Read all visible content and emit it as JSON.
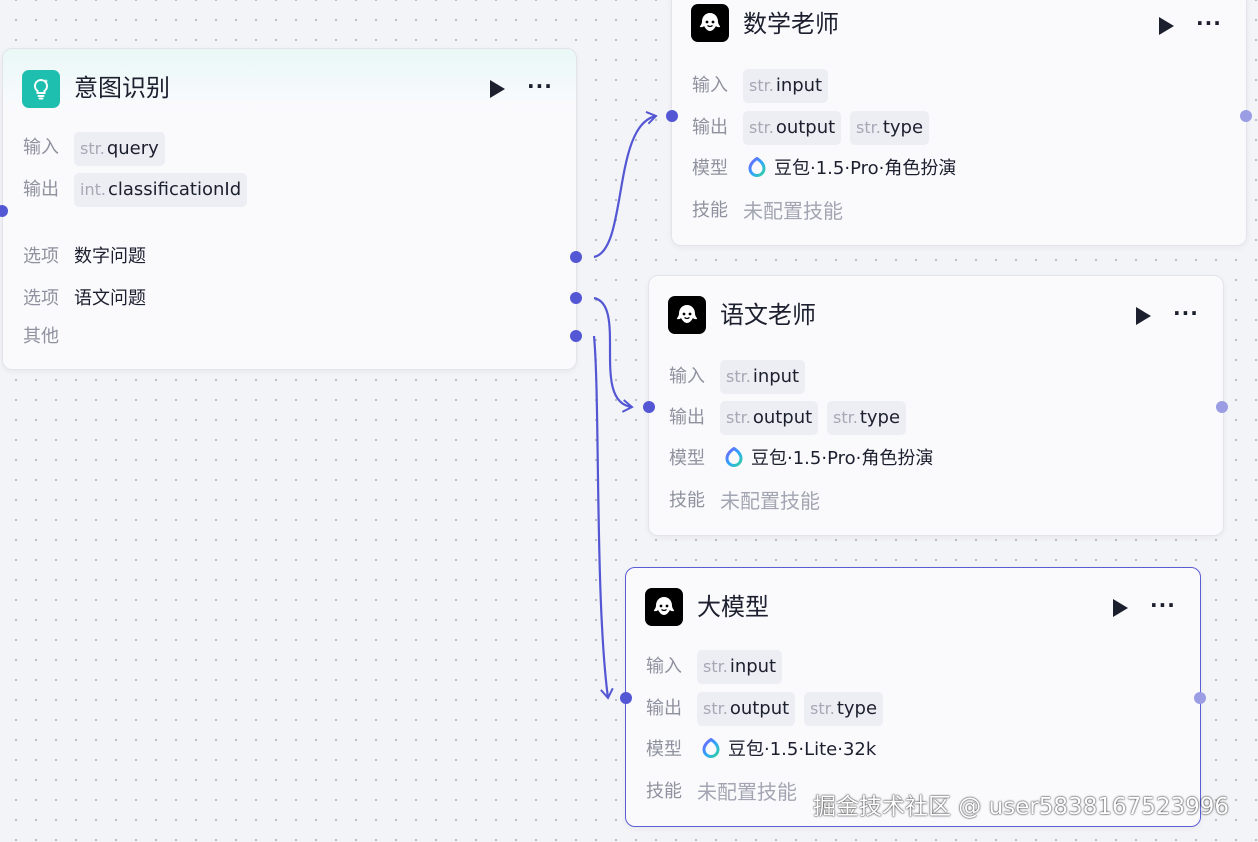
{
  "intent_node": {
    "title": "意图识别",
    "input_label": "输入",
    "input_type": "str.",
    "input_name": "query",
    "output_label": "输出",
    "output_type": "int.",
    "output_name": "classificationId",
    "options": [
      {
        "label": "选项",
        "value": "数字问题"
      },
      {
        "label": "选项",
        "value": "语文问题"
      },
      {
        "label": "其他",
        "value": ""
      }
    ]
  },
  "llm_nodes": [
    {
      "title": "数学老师",
      "input_label": "输入",
      "input_type": "str.",
      "input_name": "input",
      "output_label": "输出",
      "outputs": [
        {
          "type": "str.",
          "name": "output"
        },
        {
          "type": "str.",
          "name": "type"
        }
      ],
      "model_label": "模型",
      "model": "豆包·1.5·Pro·角色扮演",
      "skill_label": "技能",
      "skill": "未配置技能"
    },
    {
      "title": "语文老师",
      "input_label": "输入",
      "input_type": "str.",
      "input_name": "input",
      "output_label": "输出",
      "outputs": [
        {
          "type": "str.",
          "name": "output"
        },
        {
          "type": "str.",
          "name": "type"
        }
      ],
      "model_label": "模型",
      "model": "豆包·1.5·Pro·角色扮演",
      "skill_label": "技能",
      "skill": "未配置技能"
    },
    {
      "title": "大模型",
      "input_label": "输入",
      "input_type": "str.",
      "input_name": "input",
      "output_label": "输出",
      "outputs": [
        {
          "type": "str.",
          "name": "output"
        },
        {
          "type": "str.",
          "name": "type"
        }
      ],
      "model_label": "模型",
      "model": "豆包·1.5·Lite·32k",
      "skill_label": "技能",
      "skill": "未配置技能"
    }
  ],
  "colors": {
    "edge": "#5457d4",
    "selected_border": "#5c5ed6",
    "intent_icon": "#1fbfb0"
  },
  "watermark": "掘金技术社区 @ user5838167523996"
}
